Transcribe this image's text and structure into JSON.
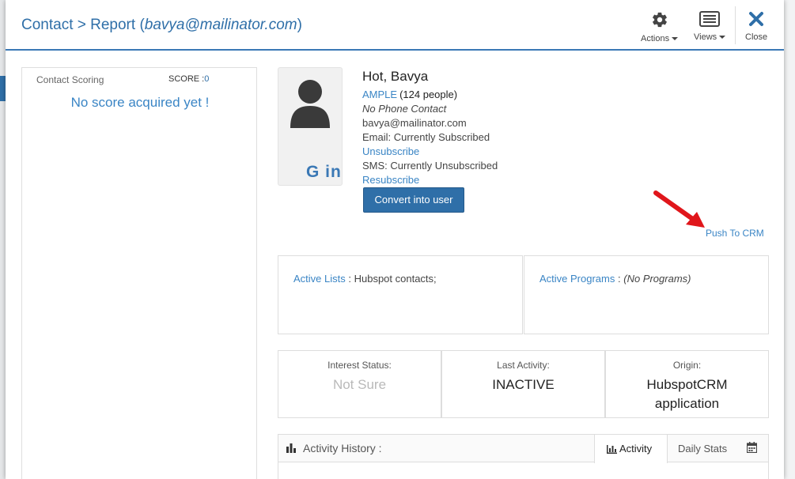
{
  "header": {
    "title_prefix": "Contact > Report (",
    "title_email": "bavya@mailinator.com",
    "title_suffix": ")",
    "actions_label": "Actions",
    "views_label": "Views",
    "close_label": "Close"
  },
  "scoring": {
    "title": "Contact Scoring",
    "score_label": "SCORE :",
    "score_value": "0",
    "message": "No score acquired yet !"
  },
  "contact": {
    "name": "Hot, Bavya",
    "company": "AMPLE",
    "company_count": "(124 people)",
    "phone": "No Phone Contact",
    "email": "bavya@mailinator.com",
    "email_status": "Email: Currently Subscribed",
    "unsubscribe_link": "Unsubscribe",
    "sms_status": "SMS: Currently Unsubscribed",
    "resubscribe_link": "Resubscribe",
    "convert_button": "Convert into user",
    "social": "G in"
  },
  "push_crm_link": "Push To CRM",
  "lists": {
    "label": "Active Lists",
    "value": ": Hubspot contacts;"
  },
  "programs": {
    "label": "Active Programs",
    "value_prefix": ":",
    "value": "(No Programs)"
  },
  "stats": {
    "interest_label": "Interest Status:",
    "interest_value": "Not Sure",
    "last_activity_label": "Last Activity:",
    "last_activity_value": "INACTIVE",
    "origin_label": "Origin:",
    "origin_value": "HubspotCRM application"
  },
  "history": {
    "title": "Activity History :",
    "tab_activity": "Activity",
    "tab_daily": "Daily Stats"
  },
  "colors": {
    "accent": "#2f6fa8",
    "link": "#3a85c5",
    "arrow": "#e0161b"
  },
  "icons": [
    "gear-icon",
    "list-icon",
    "close-icon",
    "person-icon",
    "bar-chart-icon",
    "calendar-icon"
  ]
}
